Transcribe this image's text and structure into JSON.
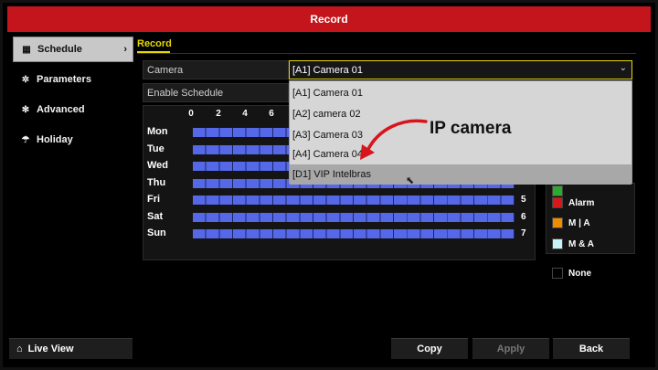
{
  "window": {
    "title": "Record"
  },
  "sidebar": {
    "items": [
      {
        "label": "Schedule",
        "icon": "calendar-icon",
        "active": true
      },
      {
        "label": "Parameters",
        "icon": "gear-icon",
        "active": false
      },
      {
        "label": "Advanced",
        "icon": "gears-icon",
        "active": false
      },
      {
        "label": "Holiday",
        "icon": "umbrella-icon",
        "active": false
      }
    ],
    "live_view": "Live View"
  },
  "tabs": [
    {
      "label": "Record",
      "active": true
    }
  ],
  "camera": {
    "label": "Camera",
    "selected": "[A1] Camera 01",
    "options": [
      "[A1] Camera 01",
      "[A2] camera 02",
      "[A3] Camera 03",
      "[A4] Camera 04",
      "[D1] VIP Intelbras"
    ]
  },
  "enable_schedule": {
    "label": "Enable Schedule"
  },
  "annotation": "IP camera",
  "schedule": {
    "hours": [
      "0",
      "2",
      "4",
      "6"
    ],
    "days": [
      {
        "name": "Mon",
        "num": ""
      },
      {
        "name": "Tue",
        "num": ""
      },
      {
        "name": "Wed",
        "num": ""
      },
      {
        "name": "Thu",
        "num": ""
      },
      {
        "name": "Fri",
        "num": "5"
      },
      {
        "name": "Sat",
        "num": "6"
      },
      {
        "name": "Sun",
        "num": "7"
      }
    ]
  },
  "legend": [
    {
      "label": "Alarm",
      "color": "#d81818"
    },
    {
      "label": "M | A",
      "color": "#f08c00"
    },
    {
      "label": "M & A",
      "color": "#c8f4f8"
    },
    {
      "label": "None",
      "color": "#000000"
    }
  ],
  "buttons": {
    "copy": "Copy",
    "apply": "Apply",
    "back": "Back"
  },
  "colors": {
    "title_bar": "#c4151c",
    "accent": "#e6d800",
    "schedule_fill": "#5468e8",
    "legend_hidden": "#2fa82f"
  }
}
